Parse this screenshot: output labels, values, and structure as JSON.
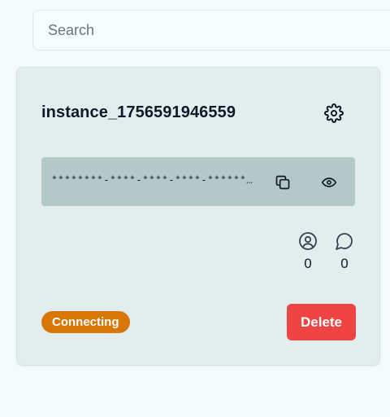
{
  "search": {
    "placeholder": "Search",
    "value": ""
  },
  "instance": {
    "name": "instance_1756591946559",
    "token_masked": "********-****-****-****-************",
    "contacts_count": "0",
    "chats_count": "0",
    "status": "Connecting",
    "delete_label": "Delete"
  },
  "icons": {
    "settings": "gear-icon",
    "copy": "copy-icon",
    "show_token": "eye-icon",
    "contacts": "user-circle-icon",
    "chats": "chat-bubble-icon"
  },
  "colors": {
    "page_background": "#f3fbfd",
    "card_background": "#e2eeee",
    "token_background": "#b4c8c8",
    "status_connecting": "#d97706",
    "delete": "#ef4444"
  }
}
